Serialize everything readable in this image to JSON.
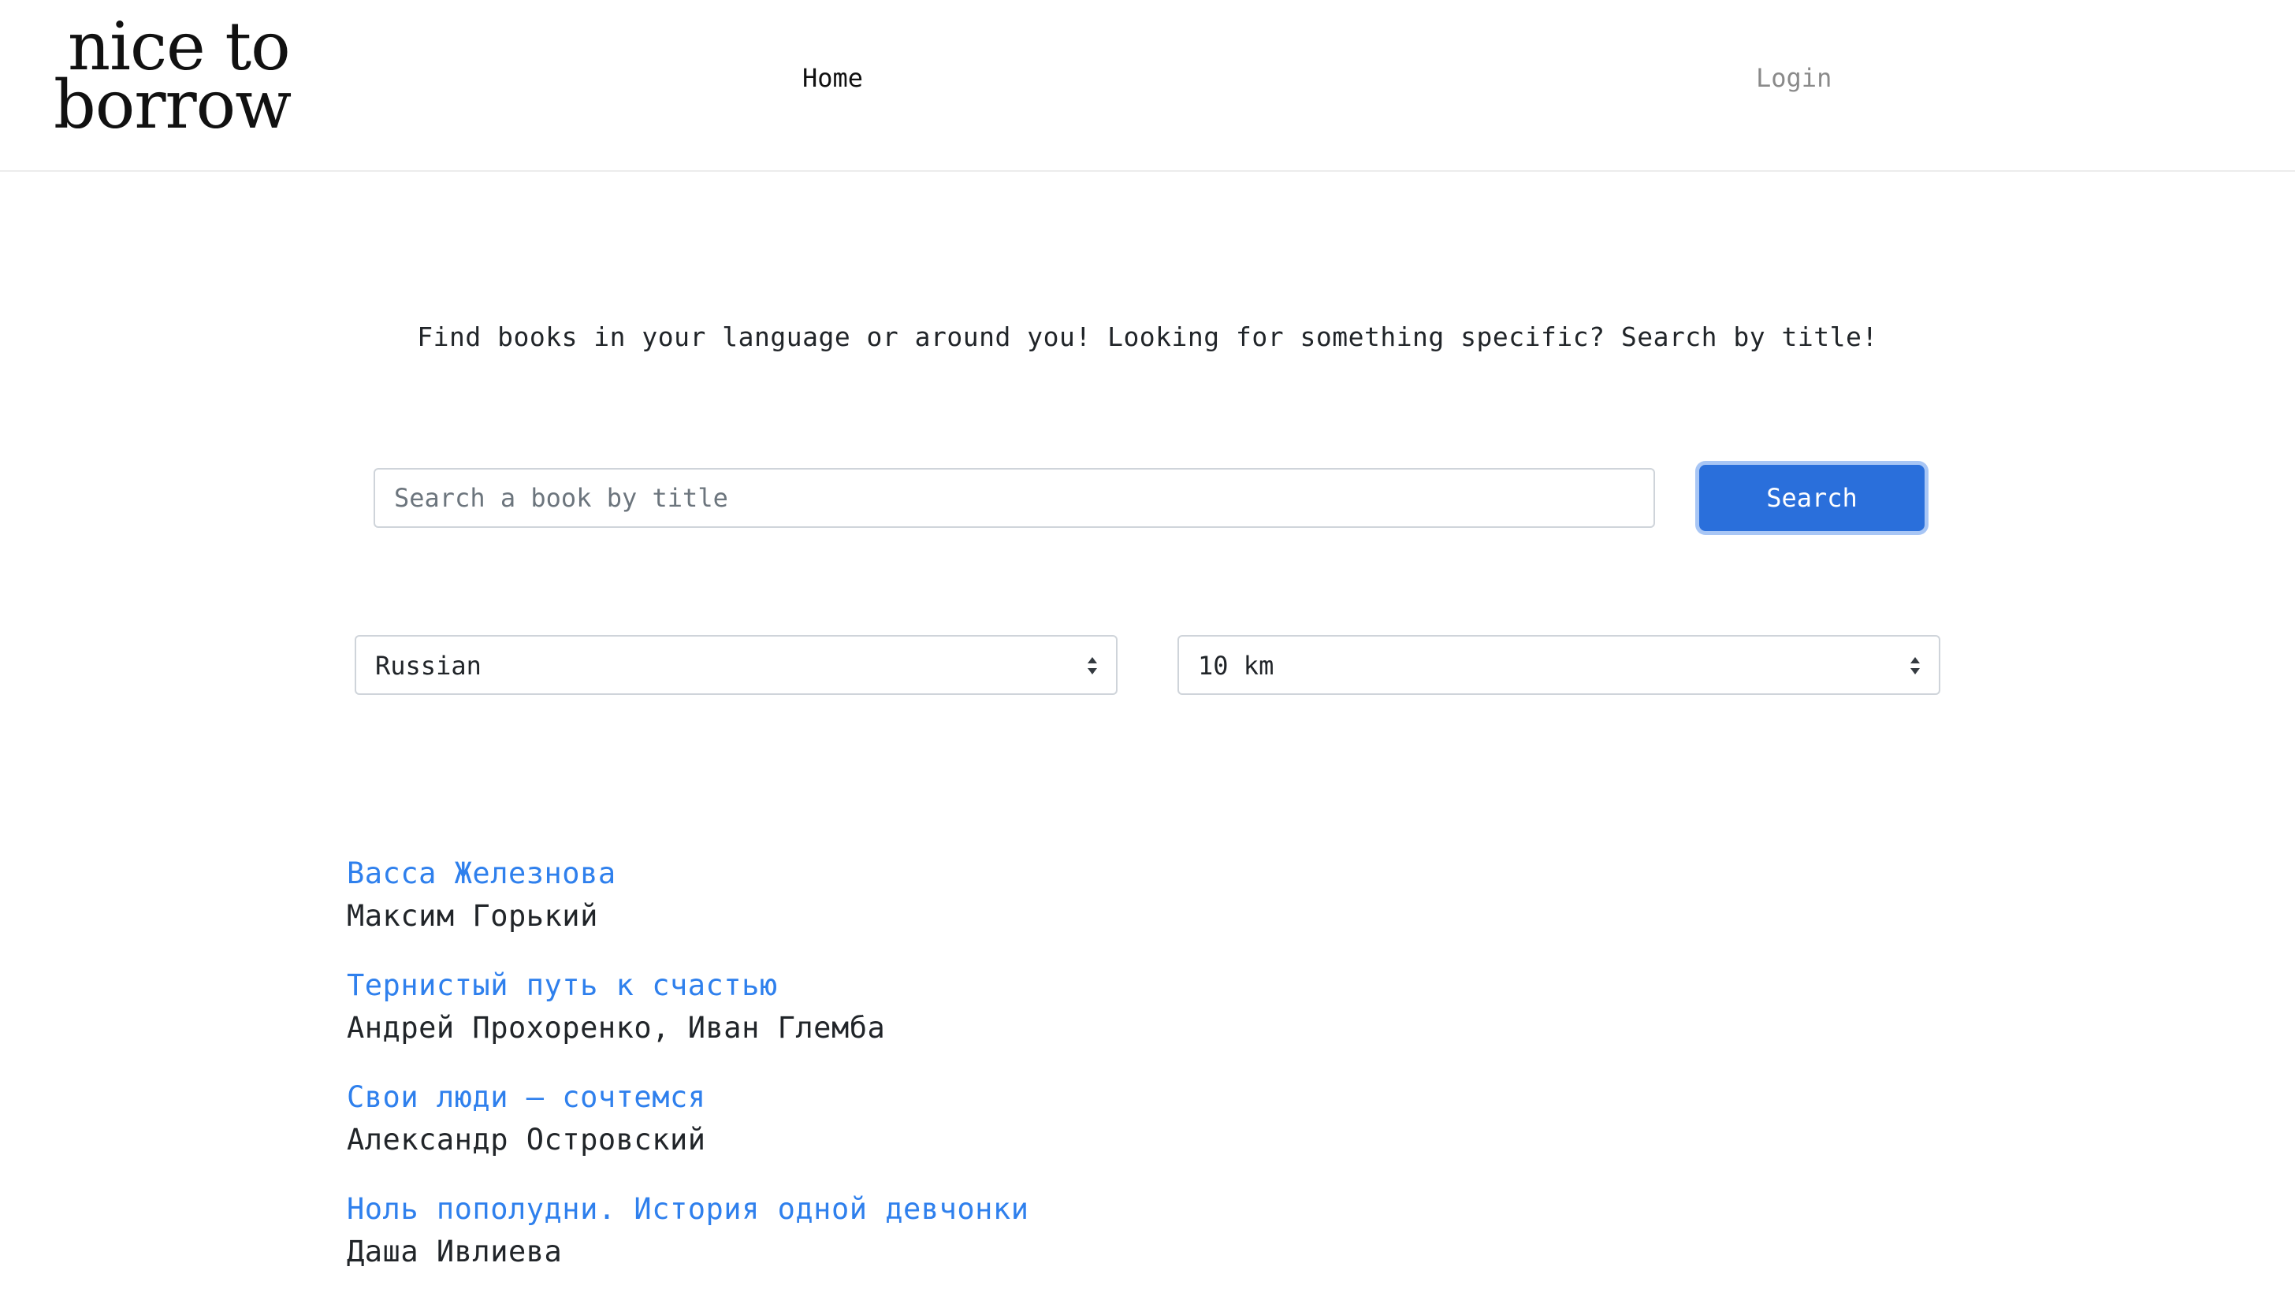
{
  "header": {
    "logo_line1": "nice to",
    "logo_line2": "borrow",
    "nav_home": "Home",
    "nav_login": "Login"
  },
  "main": {
    "tagline": "Find books in your language or around you! Looking for something specific? Search by title!",
    "search": {
      "placeholder": "Search a book by title",
      "value": "",
      "button_label": "Search"
    },
    "filters": {
      "language_selected": "Russian",
      "distance_selected": "10 km"
    },
    "books": [
      {
        "title": "Васса Железнова",
        "author": "Максим Горький"
      },
      {
        "title": "Тернистый путь к счастью",
        "author": "Андрей Прохоренко, Иван Глемба"
      },
      {
        "title": "Свои люди — сочтемся",
        "author": "Александр Островский"
      },
      {
        "title": "Ноль пополудни. История одной девчонки",
        "author": "Даша Ивлиева"
      }
    ]
  },
  "colors": {
    "accent": "#2a6fdb",
    "link": "#2f80ed",
    "muted": "#8a8a8a"
  }
}
